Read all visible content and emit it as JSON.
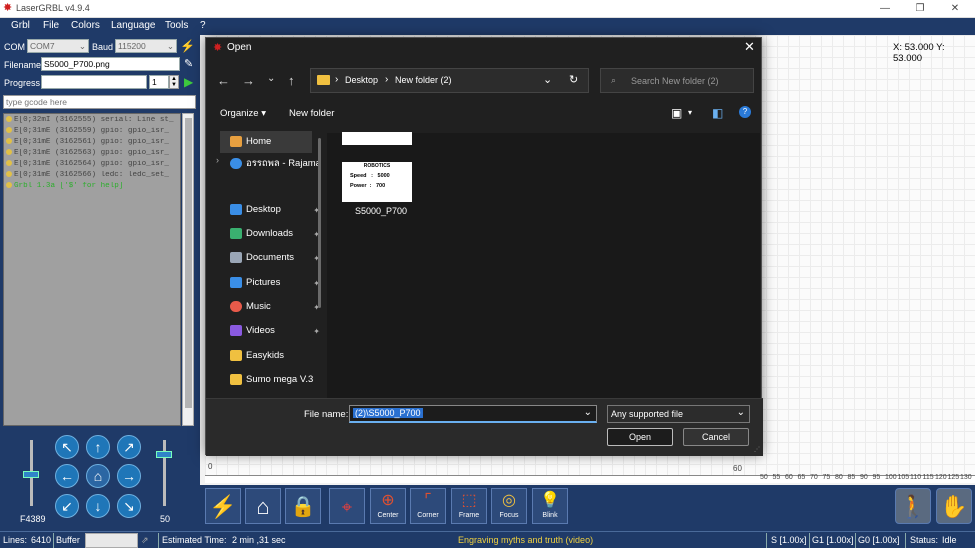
{
  "app": {
    "title": "LaserGRBL v4.9.4"
  },
  "menu": [
    "Grbl",
    "File",
    "Colors",
    "Language",
    "Tools",
    "?"
  ],
  "connection": {
    "com_label": "COM",
    "com_value": "COM7",
    "baud_label": "Baud",
    "baud_value": "115200"
  },
  "file": {
    "filename_label": "Filename",
    "filename_value": "S5000_P700.png",
    "progress_label": "Progress",
    "progress_count": "1"
  },
  "gcode": {
    "placeholder": "type gcode here"
  },
  "log": [
    "E[0;32mI (3162555) serial: Line st_",
    "E[0;31mE (3162559) gpio: gpio_isr_",
    "E[0;31mE (3162561) gpio: gpio_isr_",
    "E[0;31mE (3162563) gpio: gpio_isr_",
    "E[0;31mE (3162564) gpio: gpio_isr_",
    "E[0;31mE (3162566) ledc: ledc_set_",
    "Grbl 1.3a ['$' for help]"
  ],
  "jog": {
    "feed_label": "F4389",
    "step_label": "50"
  },
  "canvas": {
    "coords": "X: 53.000 Y: 53.000",
    "tick_0": "0",
    "tick_60": "60",
    "axis_ticks": [
      "50",
      "55",
      "60",
      "65",
      "70",
      "75",
      "80",
      "85",
      "90",
      "95",
      "100",
      "105",
      "110",
      "115",
      "120",
      "125",
      "130"
    ]
  },
  "tools": [
    "Center",
    "Corner",
    "Frame",
    "Focus",
    "Blink"
  ],
  "status": {
    "lines_label": "Lines:",
    "lines_value": "6410",
    "buffer_label": "Buffer",
    "est_label": "Estimated Time:",
    "est_value": "2 min ,31 sec",
    "hint": "Engraving myths and truth (video)",
    "s": "S [1.00x]",
    "g1": "G1 [1.00x]",
    "g0": "G0 [1.00x]",
    "state_label": "Status:",
    "state_value": "Idle"
  },
  "dialog": {
    "title": "Open",
    "breadcrumb": [
      "Desktop",
      "New folder (2)"
    ],
    "search_placeholder": "Search New folder (2)",
    "organize": "Organize",
    "new_folder": "New folder",
    "sidebar": [
      {
        "label": "Home",
        "icon": "home-icon",
        "color": "#e8a040"
      },
      {
        "label": "อรรถพล - Rajama",
        "icon": "onedrive-icon",
        "color": "#3a8ee6"
      },
      {
        "label": "Desktop",
        "icon": "desktop-icon",
        "color": "#3a8ee6"
      },
      {
        "label": "Downloads",
        "icon": "download-icon",
        "color": "#3ab070"
      },
      {
        "label": "Documents",
        "icon": "documents-icon",
        "color": "#9aa6b6"
      },
      {
        "label": "Pictures",
        "icon": "pictures-icon",
        "color": "#3a8ee6"
      },
      {
        "label": "Music",
        "icon": "music-icon",
        "color": "#e85a4a"
      },
      {
        "label": "Videos",
        "icon": "videos-icon",
        "color": "#8a5ae0"
      },
      {
        "label": "Easykids",
        "icon": "folder-icon",
        "color": "#f0c040"
      },
      {
        "label": "Sumo mega V.3",
        "icon": "folder-icon",
        "color": "#f0c040"
      }
    ],
    "file_item": {
      "name": "S5000_P700",
      "thumb_heading": "ROBOTICS",
      "thumb_speed": "Speed   :   5000",
      "thumb_power": "Power  :   700"
    },
    "filename_label": "File name:",
    "filename_value": "(2)\\S5000_P700",
    "filter_value": "Any supported file",
    "open_label": "Open",
    "cancel_label": "Cancel"
  }
}
